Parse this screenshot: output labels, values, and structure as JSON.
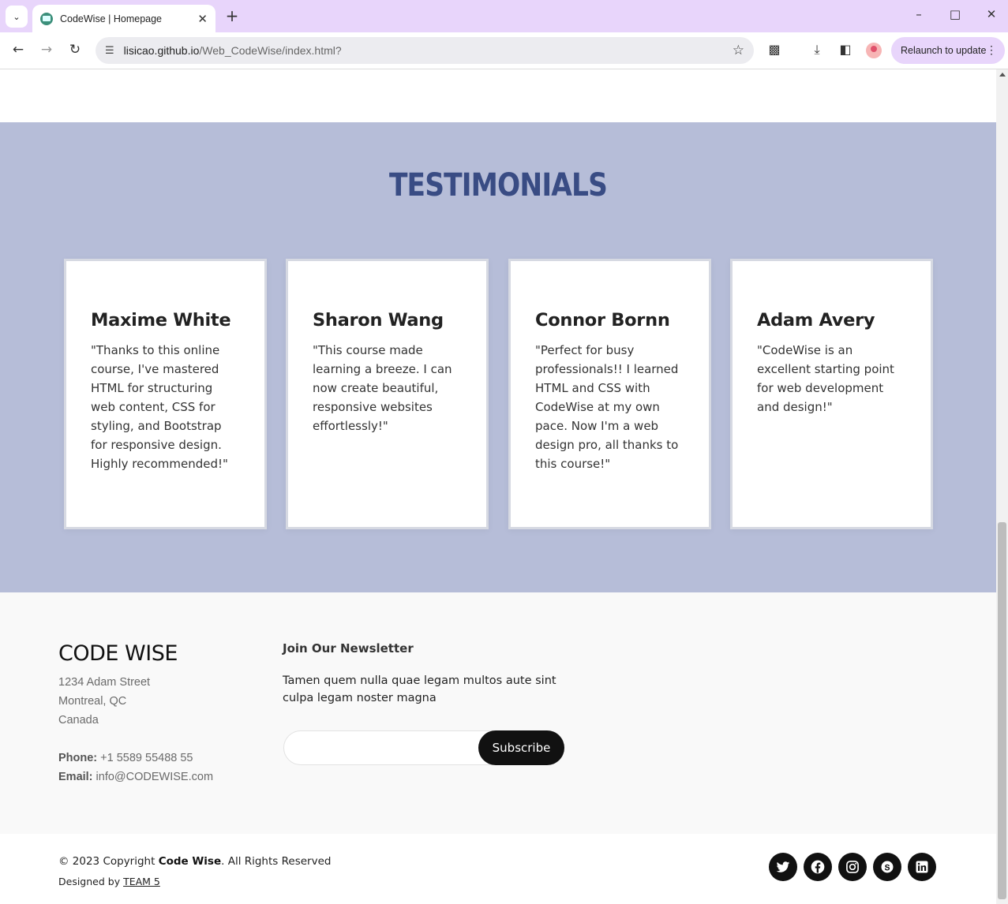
{
  "browser": {
    "tab_title": "CodeWise | Homepage",
    "url_host": "lisicao.github.io",
    "url_path": "/Web_CodeWise/index.html?",
    "relaunch_label": "Relaunch to update",
    "icons": [
      "tab-search-icon",
      "favicon",
      "close-icon",
      "plus-icon",
      "minimize-icon",
      "maximize-icon",
      "window-close-icon",
      "back-arrow-icon",
      "forward-arrow-icon",
      "reload-icon",
      "site-settings-icon",
      "star-icon",
      "extensions-icon",
      "download-icon",
      "side-panel-icon",
      "profile-avatar",
      "kebab-menu-icon"
    ]
  },
  "testimonials": {
    "title": "TESTIMONIALS",
    "cards": [
      {
        "name": "Maxime White",
        "text": "\"Thanks to this online course, I've mastered HTML for structuring web content, CSS for styling, and Bootstrap for responsive design. Highly recommended!\""
      },
      {
        "name": "Sharon Wang",
        "text": "\"This course made learning a breeze. I can now create beautiful, responsive websites effortlessly!\""
      },
      {
        "name": "Connor Bornn",
        "text": "\"Perfect for busy professionals!! I learned HTML and CSS with CodeWise at my own pace. Now I'm a web design pro, all thanks to this course!\""
      },
      {
        "name": "Adam Avery",
        "text": "\"CodeWise is an excellent starting point for web development and design!\""
      }
    ]
  },
  "footer": {
    "brand": "CODE WISE",
    "address": [
      "1234 Adam Street",
      "Montreal, QC",
      "Canada"
    ],
    "phone_label": "Phone:",
    "phone": "+1 5589 55488 55",
    "email_label": "Email:",
    "email": "info@CODEWISE.com",
    "newsletter_title": "Join Our Newsletter",
    "newsletter_text": "Tamen quem nulla quae legam multos aute sint culpa legam noster magna",
    "newsletter_input_value": "",
    "subscribe_label": "Subscribe",
    "copyright_prefix": "© 2023 Copyright ",
    "copyright_brand": "Code Wise",
    "copyright_suffix": ". All Rights Reserved",
    "designed_prefix": "Designed by ",
    "designed_link": "TEAM 5",
    "social_icons": [
      "twitter-icon",
      "facebook-icon",
      "instagram-icon",
      "skype-icon",
      "linkedin-icon"
    ]
  }
}
